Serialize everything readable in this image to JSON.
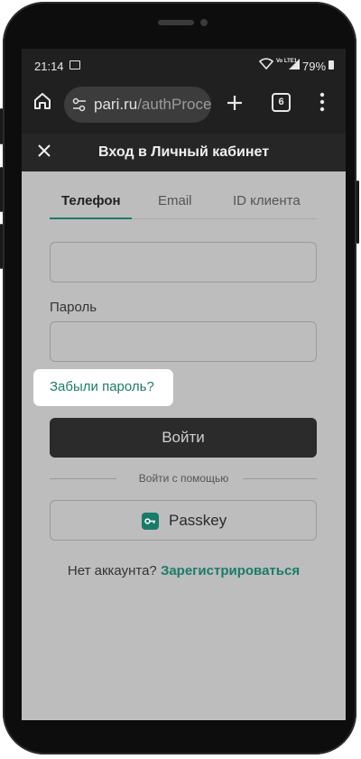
{
  "status_bar": {
    "time": "21:14",
    "network": "Vo LTE1",
    "battery": "79%"
  },
  "browser": {
    "url_host": "pari.ru",
    "url_path": "/authProce",
    "tab_count": "6"
  },
  "header": {
    "title": "Вход в Личный кабинет"
  },
  "tabs": [
    {
      "label": "Телефон",
      "active": true
    },
    {
      "label": "Email",
      "active": false
    },
    {
      "label": "ID клиента",
      "active": false
    }
  ],
  "form": {
    "phone_value": "",
    "password_label": "Пароль",
    "password_value": "",
    "forgot_password": "Забыли пароль?",
    "login_button": "Войти",
    "divider_text": "Войти с помощью",
    "passkey_button": "Passkey",
    "no_account_text": "Нет аккаунта?",
    "register_link": "Зарегистрироваться"
  },
  "colors": {
    "accent": "#1b7b6a",
    "overlay": "#bdbdbd",
    "button_dark": "#2b2b2b"
  }
}
